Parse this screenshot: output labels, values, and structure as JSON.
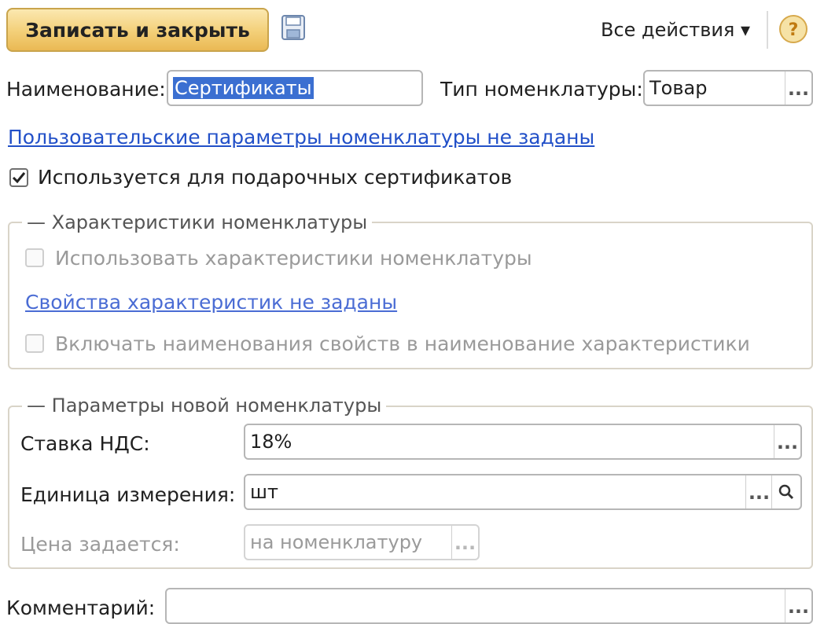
{
  "toolbar": {
    "save_close_label": "Записать и закрыть",
    "all_actions_label": "Все действия ▾",
    "help_label": "?"
  },
  "form": {
    "name_label": "Наименование:",
    "name_value": "Сертификаты",
    "type_label": "Тип номенклатуры:",
    "type_value": "Товар",
    "user_params_link": "Пользовательские параметры номенклатуры не заданы",
    "gift_cert_label": "Используется для подарочных сертификатов",
    "gift_cert_checked": true,
    "comment_label": "Комментарий:",
    "comment_value": ""
  },
  "characteristics": {
    "title": "Характеристики номенклатуры",
    "use_label": "Использовать характеристики номенклатуры",
    "props_link": "Свойства характеристик не заданы",
    "include_label": "Включать наименования свойств в наименование характеристики"
  },
  "new_params": {
    "title": "Параметры новой номенклатуры",
    "vat_label": "Ставка НДС:",
    "vat_value": "18%",
    "unit_label": "Единица измерения:",
    "unit_value": "шт",
    "price_label": "Цена задается:",
    "price_value": "на номенклатуру"
  },
  "buttons": {
    "choose": "..."
  },
  "colors": {
    "accent": "#f3cf78",
    "link": "#2250c8",
    "selection": "#3b6fd1"
  }
}
